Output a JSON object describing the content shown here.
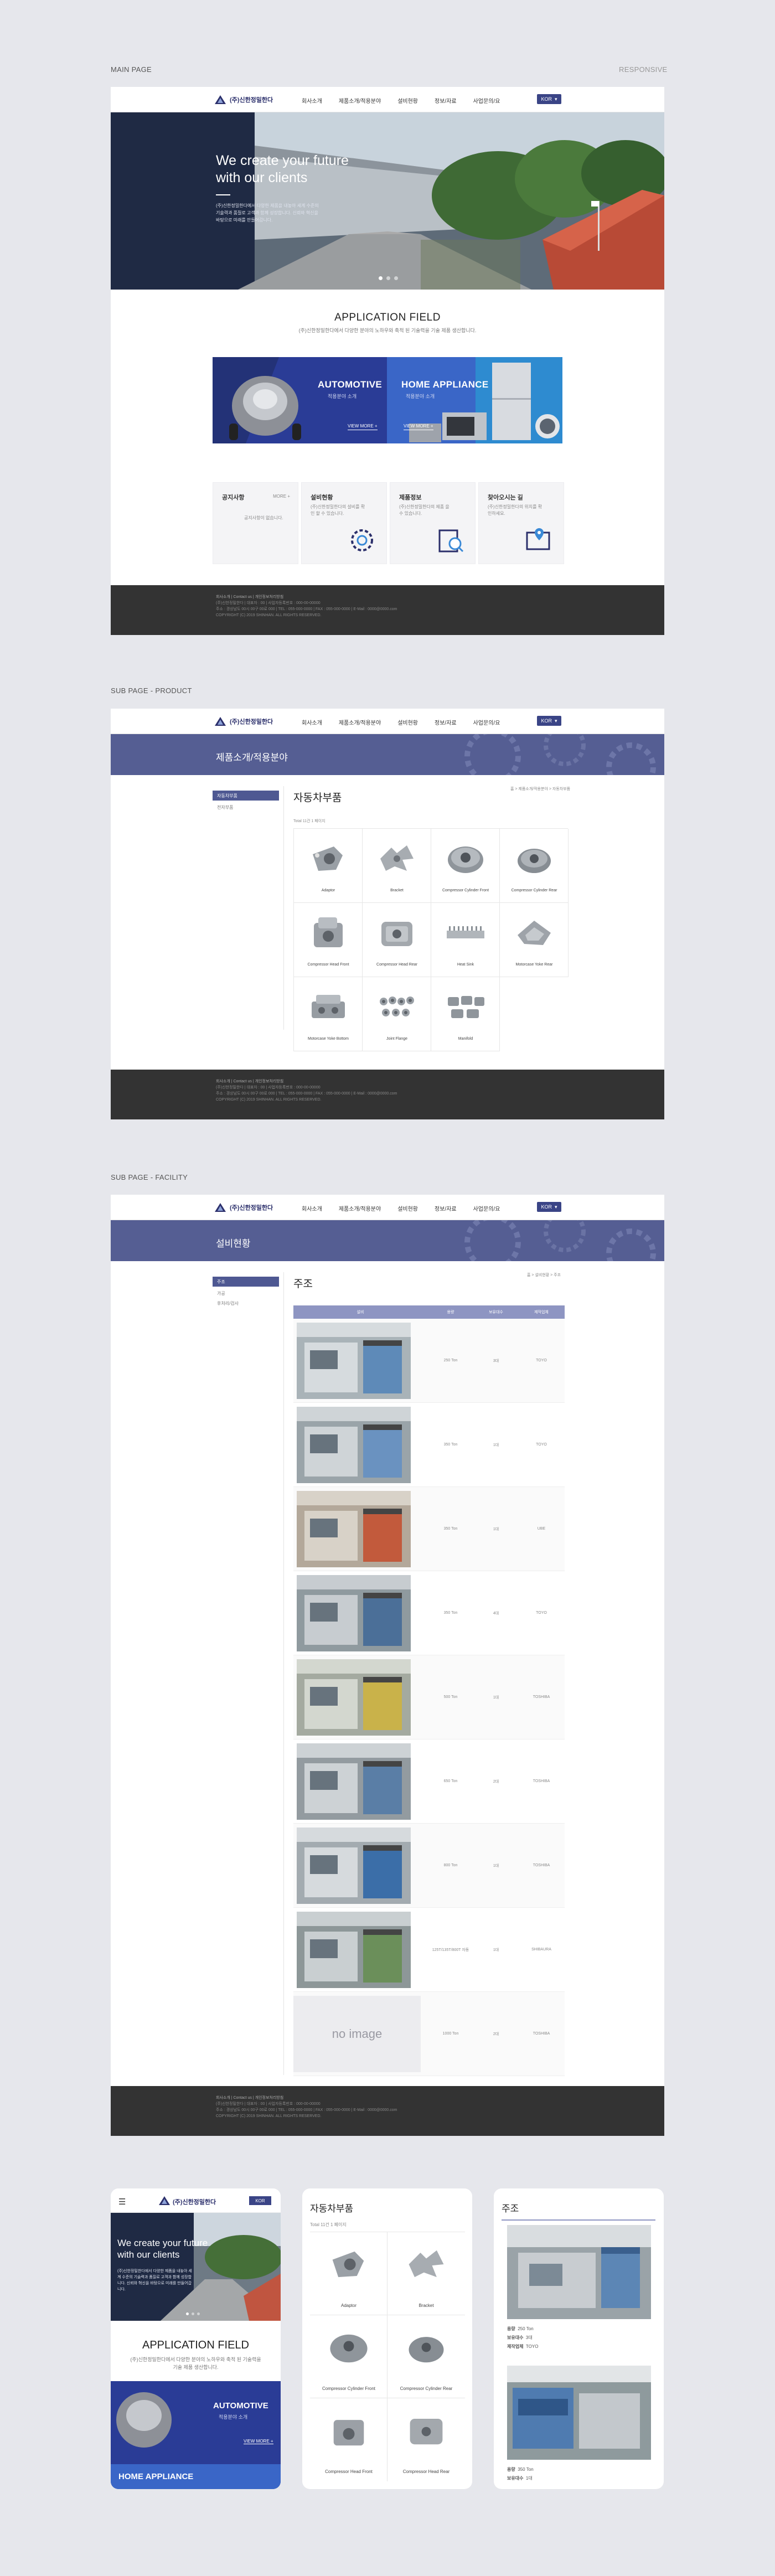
{
  "labels": {
    "main": "MAIN PAGE",
    "responsive": "RESPONSIVE",
    "sub_product": "SUB PAGE - PRODUCT",
    "sub_facility": "SUB PAGE - FACILITY"
  },
  "header": {
    "logo": "(주)신한정밀한다",
    "nav": [
      "회사소개",
      "제품소개/적용분야",
      "설비현황",
      "정보/자료",
      "사업문의/요"
    ],
    "lang": "KOR"
  },
  "hero": {
    "title_line1": "We create your  future",
    "title_line2": "with our clients",
    "desc": "(주)신한정밀한다에서 다양한 제품을 내놓아 세계 수준의 기술력과 품질로 고객과 함께 성장합니다. 신뢰와 혁신을 바탕으로 미래를 만들어갑니다."
  },
  "application": {
    "title": "APPLICATION FIELD",
    "subtitle": "(주)신한정밀한다에서 다양한 분야의 노하우와 축적 된 기술력을 기술 제품 생산합니다.",
    "panels": [
      {
        "title": "AUTOMOTIVE",
        "sub": "적용분야 소개",
        "more": "VIEW MORE +"
      },
      {
        "title": "HOME APPLIANCE",
        "sub": "적용분야 소개",
        "more": "VIEW MORE +"
      }
    ]
  },
  "cards": [
    {
      "title": "공지사항",
      "desc": "공지사항이 없습니다.",
      "more": "MORE +"
    },
    {
      "title": "설비현황",
      "desc": "(주)신한정밀한다의 설비를 확인 할 수 있습니다.",
      "more": ""
    },
    {
      "title": "제품정보",
      "desc": "(주)신한정밀한다의 제품 을 수 있습니다.",
      "more": ""
    },
    {
      "title": "찾아오시는 길",
      "desc": "(주)신한정밀한다의 위치를 확인하세요.",
      "more": ""
    }
  ],
  "footer": {
    "line1": "회사소개  |  Contact us  |  개인정보처리방침",
    "line2": "(주)신한정밀한다  |  대표자 : 00  |  사업자등록번호 : 000-00-00000",
    "line3": "주소 : 경상남도 00시 00구 00로 000  |  TEL : 055-000-0000  |  FAX : 055-000-0000  |  E-Mail : 0000@0000.com",
    "line4": "COPYRIGHT (C) 2019 SHINHAN. ALL RIGHTS RESERVED."
  },
  "product_page": {
    "banner": "제품소개/적용분야",
    "side": [
      "자동차부품",
      "전자부품"
    ],
    "title": "자동차부품",
    "crumb": "홈 > 제품소개/적용분야 > 자동차부품",
    "total": "Total 11건 1 페이지",
    "items": [
      "Adaptor",
      "Bracket",
      "Compressor Cylinder Front",
      "Compressor Cylinder Rear",
      "Compressor Head Front",
      "Compressor Head Rear",
      "Heat Sink",
      "Motorcase Yoke Rear",
      "Motorcase Yoke Bottom",
      "Joint Flange",
      "Manifold"
    ]
  },
  "facility_page": {
    "banner": "설비현황",
    "side": [
      "주조",
      "가공",
      "후처리/검사"
    ],
    "title": "주조",
    "crumb": "홈 > 설비현황 > 주조",
    "columns": [
      "설비",
      "용량",
      "보유대수",
      "제작업체"
    ],
    "rows": [
      {
        "cap": "250 Ton",
        "qty": "3대",
        "maker": "TOYO"
      },
      {
        "cap": "350 Ton",
        "qty": "1대",
        "maker": "TOYO"
      },
      {
        "cap": "350 Ton",
        "qty": "1대",
        "maker": "UBE"
      },
      {
        "cap": "350 Ton",
        "qty": "4대",
        "maker": "TOYO"
      },
      {
        "cap": "500 Ton",
        "qty": "1대",
        "maker": "TOSHIBA"
      },
      {
        "cap": "650 Ton",
        "qty": "2대",
        "maker": "TOSHIBA"
      },
      {
        "cap": "800 Ton",
        "qty": "1대",
        "maker": "TOSHIBA"
      },
      {
        "cap": "125T/135T/800T 자동",
        "qty": "1대",
        "maker": "SHIBAURA"
      },
      {
        "cap": "1000 Ton",
        "qty": "2대",
        "maker": "TOSHIBA"
      }
    ],
    "noimage": "no image"
  },
  "mobile": {
    "m1": {
      "logo": "(주)신한정밀한다",
      "lang": "KOR",
      "hero1": "We create your  future",
      "hero2": "with our clients",
      "app": "APPLICATION FIELD",
      "app_sub": "(주)신한정밀한다에서 다양한 분야의 노하우와 축적 된 기술력을 기술 제품 생산합니다.",
      "auto": "AUTOMOTIVE",
      "auto_sub": "적용분야 소개",
      "more": "VIEW MORE +",
      "home": "HOME APPLIANCE"
    },
    "m2": {
      "title": "자동차부품",
      "total": "Total 11건 1 페이지",
      "items": [
        "Adaptor",
        "Bracket",
        "Compressor Cylinder Front",
        "Compressor Cylinder Rear",
        "Compressor Head Front",
        "Compressor Head Rear"
      ]
    },
    "m3": {
      "title": "주조",
      "rows": [
        {
          "k1": "용량",
          "v1": "250 Ton",
          "k2": "보유대수",
          "v2": "3대",
          "k3": "제작업체",
          "v3": "TOYO"
        },
        {
          "k1": "용량",
          "v1": "350 Ton",
          "k2": "보유대수",
          "v2": "1대"
        }
      ]
    }
  }
}
